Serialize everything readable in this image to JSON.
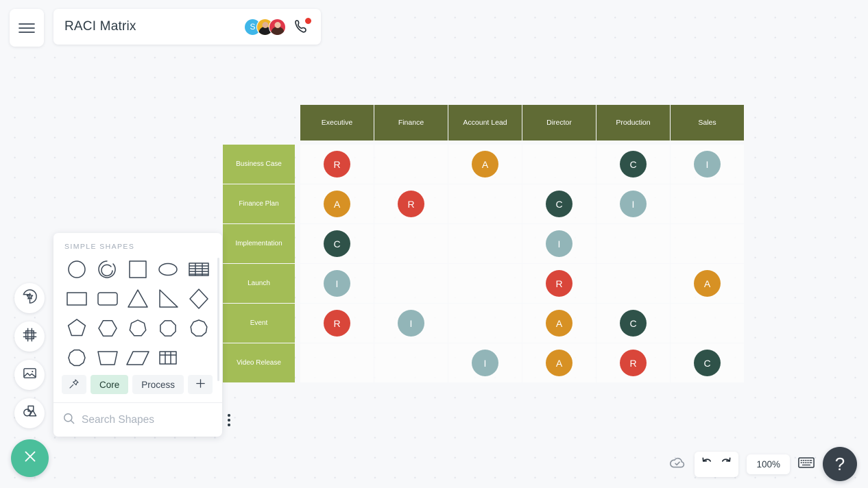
{
  "header": {
    "menu_icon": "hamburger-icon",
    "title": "RACI Matrix",
    "avatars": [
      {
        "name": "avatar-s",
        "initial": "S",
        "type": "initial"
      },
      {
        "name": "avatar-2",
        "initial": "",
        "type": "photo"
      },
      {
        "name": "avatar-3",
        "initial": "",
        "type": "photo"
      }
    ],
    "call_icon": "phone-icon",
    "call_badge": true
  },
  "matrix": {
    "columns": [
      "Executive",
      "Finance",
      "Account Lead",
      "Director",
      "Production",
      "Sales"
    ],
    "rows": [
      "Business Case",
      "Finance Plan",
      "Implementation",
      "Launch",
      "Event",
      "Video Release"
    ],
    "cells": [
      [
        "R",
        "",
        "A",
        "",
        "C",
        "I"
      ],
      [
        "A",
        "R",
        "",
        "C",
        "I",
        ""
      ],
      [
        "C",
        "",
        "",
        "I",
        "",
        ""
      ],
      [
        "I",
        "",
        "",
        "R",
        "",
        "A"
      ],
      [
        "R",
        "I",
        "",
        "A",
        "C",
        ""
      ],
      [
        "",
        "",
        "I",
        "A",
        "R",
        "C"
      ]
    ],
    "legend_colors": {
      "R": "#d9463a",
      "A": "#d79124",
      "C": "#2f5249",
      "I": "#92b5b8"
    },
    "header_color": "#606b35",
    "row_header_color": "#a3bd56"
  },
  "left_toolbar": [
    {
      "name": "sticker-icon",
      "label": "Stickers"
    },
    {
      "name": "frame-icon",
      "label": "Frames"
    },
    {
      "name": "image-icon",
      "label": "Images"
    },
    {
      "name": "shapes-icon",
      "label": "Shapes"
    }
  ],
  "shapes_panel": {
    "section_label": "SIMPLE SHAPES",
    "shapes": [
      "circle-shape",
      "arc-shape",
      "square-shape",
      "ellipse-shape",
      "striped-table-shape",
      "rectangle-shape",
      "rounded-rectangle-shape",
      "triangle-shape",
      "right-triangle-shape",
      "diamond-shape",
      "pentagon-shape",
      "hexagon-shape",
      "heptagon-shape",
      "octagon-shape",
      "nonagon-shape",
      "decagon-shape",
      "trapezoid-shape",
      "parallelogram-shape",
      "table-grid-shape"
    ],
    "tabs": [
      {
        "name": "pin-tab",
        "label": "",
        "icon": "pin-icon",
        "active": false
      },
      {
        "name": "core-tab",
        "label": "Core",
        "active": true
      },
      {
        "name": "process-tab",
        "label": "Process",
        "active": false
      },
      {
        "name": "add-tab",
        "label": "+",
        "active": false
      }
    ],
    "search_placeholder": "Search Shapes",
    "search_value": "",
    "more_icon": "kebab-menu-icon"
  },
  "close_button": {
    "icon": "close-icon",
    "color": "#4bbf9b"
  },
  "bottom_bar": {
    "cloud_icon": "cloud-saved-icon",
    "undo_icon": "undo-icon",
    "redo_icon": "redo-icon",
    "zoom_level": "100%",
    "keyboard_icon": "keyboard-icon",
    "help_label": "?"
  }
}
